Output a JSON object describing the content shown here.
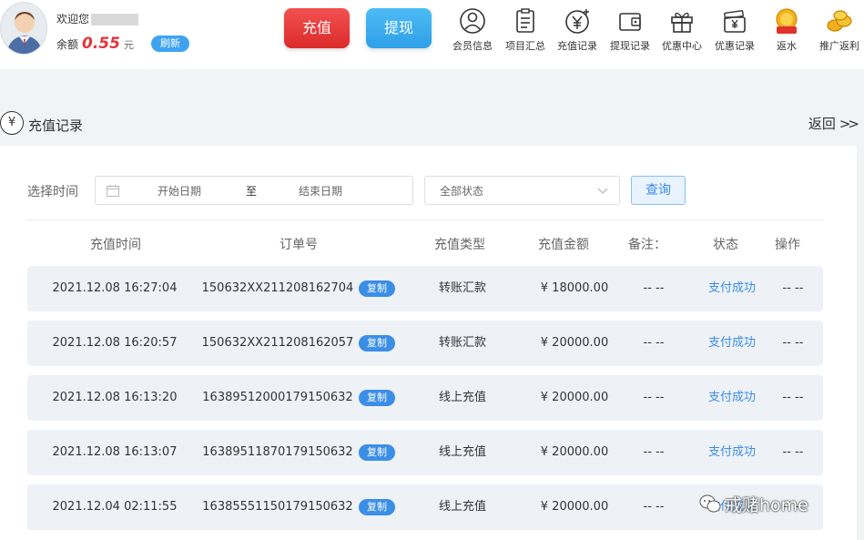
{
  "header": {
    "welcome_label": "欢迎您",
    "balance_label": "余额",
    "balance_amount": "0.55",
    "balance_unit": "元",
    "refresh_label": "刷新",
    "recharge_label": "充值",
    "withdraw_label": "提现",
    "nav": [
      {
        "label": "会员信息",
        "icon": "user-icon"
      },
      {
        "label": "项目汇总",
        "icon": "clipboard-icon"
      },
      {
        "label": "充值记录",
        "icon": "yen-coin-icon"
      },
      {
        "label": "提现记录",
        "icon": "wallet-icon"
      },
      {
        "label": "优惠中心",
        "icon": "gift-icon"
      },
      {
        "label": "优惠记录",
        "icon": "cash-card-icon"
      },
      {
        "label": "返水",
        "icon": "rebate-gold-icon",
        "badge": "返水金"
      },
      {
        "label": "推广返利",
        "icon": "gold-coins-icon"
      }
    ]
  },
  "section": {
    "icon_glyph": "¥",
    "title": "充值记录",
    "back_label": "返回",
    "back_chevrons": ">>"
  },
  "filter": {
    "time_label": "选择时间",
    "start_placeholder": "开始日期",
    "separator": "至",
    "end_placeholder": "结束日期",
    "status_value": "全部状态",
    "query_label": "查询"
  },
  "table": {
    "headers": [
      "充值时间",
      "订单号",
      "充值类型",
      "充值金额",
      "备注：",
      "状态",
      "操作"
    ],
    "copy_label": "复制",
    "rows": [
      {
        "time": "2021.12.08 16:27:04",
        "order": "150632XX211208162704",
        "type": "转账汇款",
        "amount": "¥ 18000.00",
        "note": "-- --",
        "status": "支付成功",
        "action": "-- --"
      },
      {
        "time": "2021.12.08 16:20:57",
        "order": "150632XX211208162057",
        "type": "转账汇款",
        "amount": "¥ 20000.00",
        "note": "-- --",
        "status": "支付成功",
        "action": "-- --"
      },
      {
        "time": "2021.12.08 16:13:20",
        "order": "1638951200017915063​2",
        "type": "线上充值",
        "amount": "¥ 20000.00",
        "note": "-- --",
        "status": "支付成功",
        "action": "-- --"
      },
      {
        "time": "2021.12.08 16:13:07",
        "order": "1638951187017915063​2",
        "type": "线上充值",
        "amount": "¥ 20000.00",
        "note": "-- --",
        "status": "支付成功",
        "action": "-- --"
      },
      {
        "time": "2021.12.04 02:11:55",
        "order": "1638555115017915063​2",
        "type": "线上充值",
        "amount": "¥ 20000.00",
        "note": "-- --",
        "status": "支付成功",
        "action": "-- --"
      }
    ]
  },
  "watermark": {
    "text": "戒赌home",
    "icon": "wechat-icon"
  },
  "colors": {
    "recharge": "#e8333a",
    "withdraw": "#3fa3f0",
    "accent": "#3a8ee6",
    "row_bg": "#eef1f6"
  }
}
